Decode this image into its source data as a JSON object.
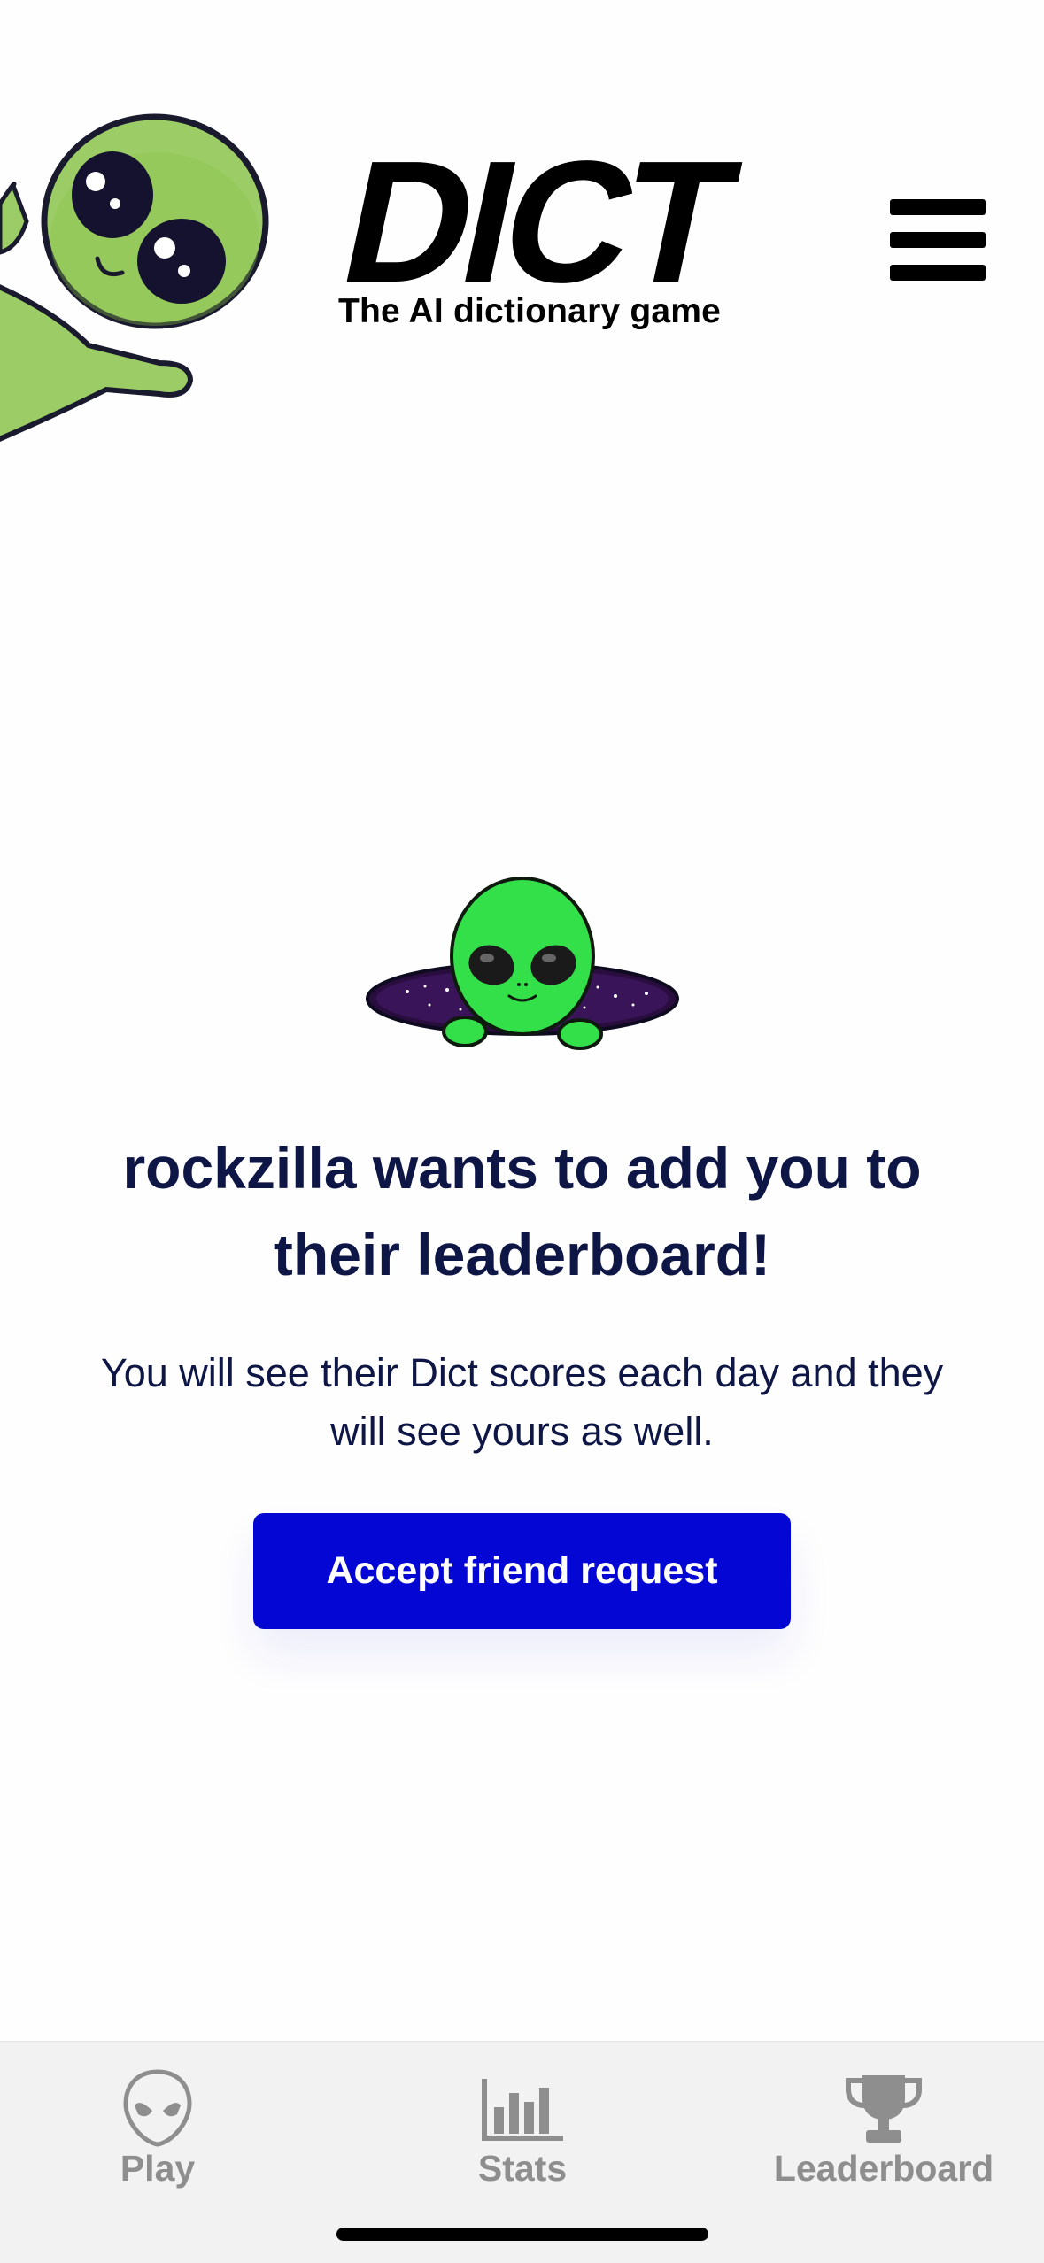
{
  "header": {
    "logo_text": "DICT",
    "tagline": "The AI dictionary game",
    "menu_icon": "hamburger-menu-icon"
  },
  "invite": {
    "title": "rockzilla wants to add you to their leaderboard!",
    "body": "You will see their Dict scores each day and they will see yours as well.",
    "accept_label": "Accept friend request",
    "accent_color": "#0406d3",
    "text_color": "#0e1646"
  },
  "tabs": [
    {
      "label": "Play",
      "icon": "alien-head-icon"
    },
    {
      "label": "Stats",
      "icon": "bar-chart-icon"
    },
    {
      "label": "Leaderboard",
      "icon": "trophy-icon"
    }
  ]
}
